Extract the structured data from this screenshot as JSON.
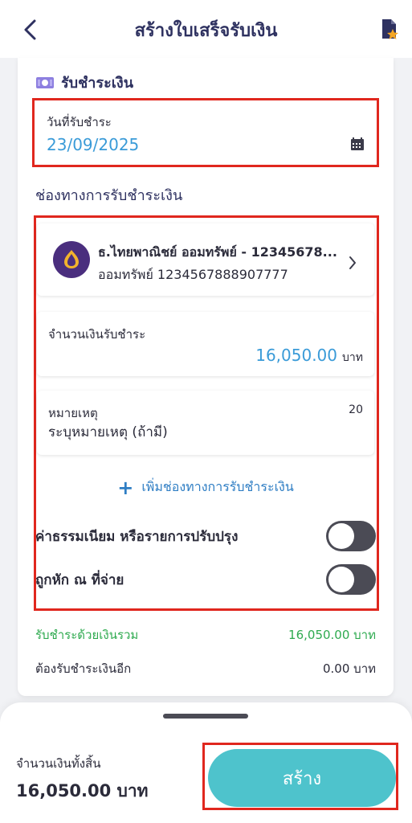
{
  "header": {
    "title": "สร้างใบเสร็จรับเงิน",
    "back_icon": "back-arrow-icon",
    "doc_icon": "document-star-icon"
  },
  "payment": {
    "section_title": "รับชำระเงิน",
    "date_label": "วันที่รับชำระ",
    "date_value": "23/09/2025",
    "channels_title": "ช่องทางการรับชำระเงิน",
    "bank": {
      "name": "ธ.ไทยพาณิชย์ ออมทรัพย์ - 12345678...",
      "account": "ออมทรัพย์ 1234567888907777"
    },
    "amount_label": "จำนวนเงินรับชำระ",
    "amount_value": "16,050.00",
    "amount_unit": "บาท",
    "note_label": "หมายเหตุ",
    "note_count": "20",
    "note_placeholder": "ระบุหมายเหตุ (ถ้ามี)",
    "add_channel": "เพิ่มช่องทางการรับชำระเงิน",
    "fee_toggle_label": "ค่าธรรมเนียม หรือรายการปรับปรุง",
    "fee_toggle_on": false,
    "wht_toggle_label": "ถูกหัก ณ ที่จ่าย",
    "wht_toggle_on": false
  },
  "summary": {
    "paid_label": "รับชำระด้วยเงินรวม",
    "paid_value": "16,050.00 บาท",
    "remaining_label": "ต้องรับชำระเงินอีก",
    "remaining_value": "0.00 บาท"
  },
  "footer": {
    "total_label": "จำนวนเงินทั้งสิ้น",
    "total_value": "16,050.00 บาท",
    "create_label": "สร้าง"
  },
  "colors": {
    "accent_blue": "#3a9bd8",
    "green": "#2eaa4f",
    "button": "#4ec3cc",
    "highlight": "#e0271e",
    "bank_brand": "#4a2e7e"
  }
}
